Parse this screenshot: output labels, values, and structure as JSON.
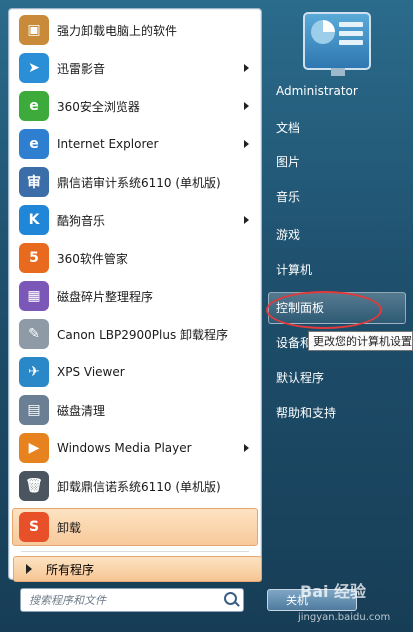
{
  "left_items": [
    {
      "label": "强力卸载电脑上的软件",
      "icon": "uninstall-box-icon",
      "color": "#c98a3a",
      "arrow": false
    },
    {
      "label": "迅雷影音",
      "icon": "xunlei-player-icon",
      "color": "#2a8fd6",
      "arrow": true
    },
    {
      "label": "360安全浏览器",
      "icon": "360-browser-icon",
      "color": "#3cab3c",
      "arrow": true
    },
    {
      "label": "Internet Explorer",
      "icon": "ie-icon",
      "color": "#2f7fd0",
      "arrow": true
    },
    {
      "label": "鼎信诺审计系统6110 (单机版)",
      "icon": "audit-system-icon",
      "color": "#3b6ea8",
      "arrow": false
    },
    {
      "label": "酷狗音乐",
      "icon": "kugou-icon",
      "color": "#1f86d8",
      "arrow": true
    },
    {
      "label": "360软件管家",
      "icon": "360-softmgr-icon",
      "color": "#e86a1f",
      "arrow": false
    },
    {
      "label": "磁盘碎片整理程序",
      "icon": "defrag-icon",
      "color": "#7b58b8",
      "arrow": false
    },
    {
      "label": "Canon LBP2900Plus 卸载程序",
      "icon": "printer-uninstall-icon",
      "color": "#8e9aa6",
      "arrow": false
    },
    {
      "label": "XPS Viewer",
      "icon": "xps-viewer-icon",
      "color": "#2b88c8",
      "arrow": false
    },
    {
      "label": "磁盘清理",
      "icon": "disk-cleanup-icon",
      "color": "#6a7f94",
      "arrow": false
    },
    {
      "label": "Windows Media Player",
      "icon": "media-player-icon",
      "color": "#e6831f",
      "arrow": true
    },
    {
      "label": "卸载鼎信诺系统6110 (单机版)",
      "icon": "trash-icon",
      "color": "#4a5560",
      "arrow": false
    },
    {
      "label": "卸载",
      "icon": "sogou-uninstall-icon",
      "color": "#e8502a",
      "arrow": false,
      "selected": true
    }
  ],
  "icon_glyphs": {
    "uninstall-box-icon": "▣",
    "xunlei-player-icon": "➤",
    "360-browser-icon": "e",
    "ie-icon": "e",
    "audit-system-icon": "审",
    "kugou-icon": "K",
    "360-softmgr-icon": "5",
    "defrag-icon": "▦",
    "printer-uninstall-icon": "✎",
    "xps-viewer-icon": "✈",
    "disk-cleanup-icon": "▤",
    "media-player-icon": "▶",
    "trash-icon": "🗑",
    "sogou-uninstall-icon": "S"
  },
  "all_programs": "所有程序",
  "search_placeholder": "搜索程序和文件",
  "right_items": [
    {
      "label": "Administrator"
    },
    {
      "label": "文档"
    },
    {
      "label": "图片"
    },
    {
      "label": "音乐"
    },
    {
      "label": "游戏"
    },
    {
      "label": "计算机"
    },
    {
      "label": "控制面板",
      "highlighted": true
    },
    {
      "label": "设备和打印机"
    },
    {
      "label": "默认程序"
    },
    {
      "label": "帮助和支持"
    }
  ],
  "tooltip": "更改您的计算机设置",
  "shutdown_label": "关机",
  "watermark": "Bai 经验",
  "watermark_url": "jingyan.baidu.com",
  "colors": {
    "selection": "#f8c99b",
    "annotation": "#e03a3a",
    "panel": "#ffffff"
  }
}
